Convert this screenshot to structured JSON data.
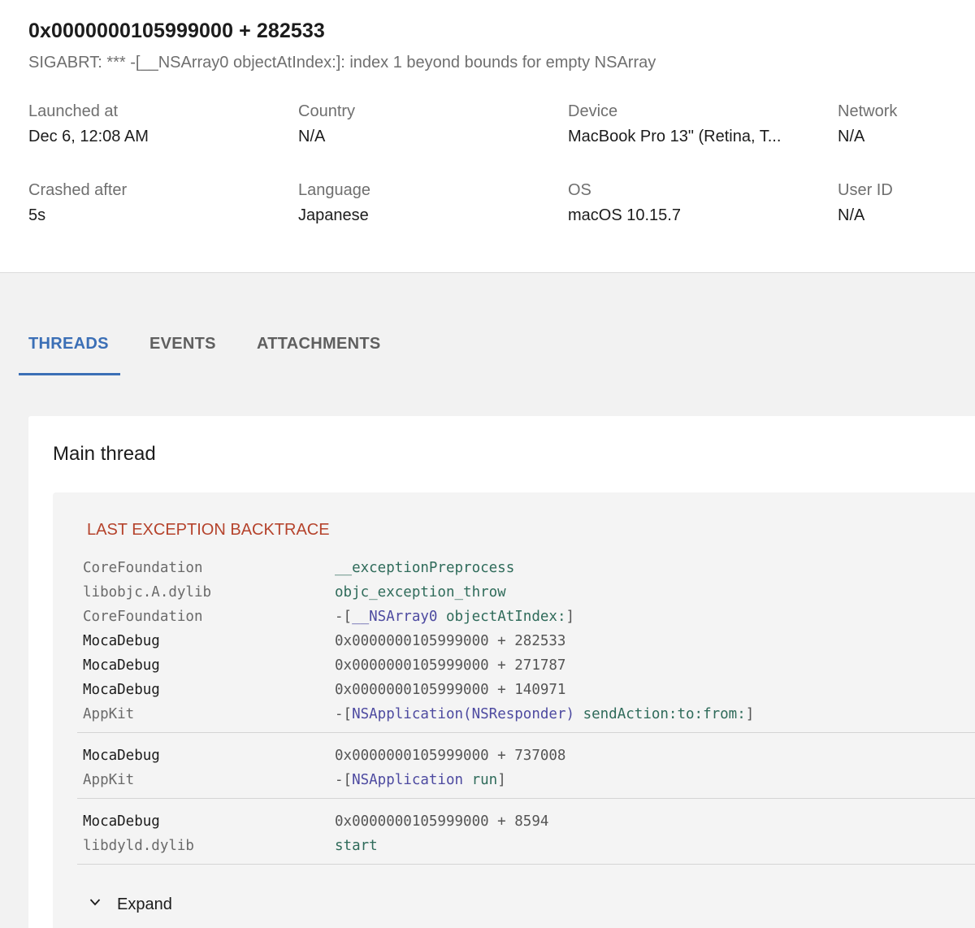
{
  "header": {
    "title": "0x0000000105999000 + 282533",
    "subtitle": "SIGABRT: *** -[__NSArray0 objectAtIndex:]: index 1 beyond bounds for empty NSArray"
  },
  "meta": {
    "launched_label": "Launched at",
    "launched_value": "Dec 6, 12:08 AM",
    "country_label": "Country",
    "country_value": "N/A",
    "device_label": "Device",
    "device_value": "MacBook Pro 13\" (Retina, T...",
    "network_label": "Network",
    "network_value": "N/A",
    "crashed_label": "Crashed after",
    "crashed_value": "5s",
    "language_label": "Language",
    "language_value": "Japanese",
    "os_label": "OS",
    "os_value": "macOS 10.15.7",
    "userid_label": "User ID",
    "userid_value": "N/A"
  },
  "tabs": [
    {
      "label": "THREADS",
      "active": true
    },
    {
      "label": "EVENTS",
      "active": false
    },
    {
      "label": "ATTACHMENTS",
      "active": false
    }
  ],
  "thread": {
    "title": "Main thread",
    "section_label": "LAST EXCEPTION BACKTRACE",
    "expand_label": "Expand",
    "groups": [
      [
        {
          "lib": "CoreFoundation",
          "app": false,
          "sym": "__exceptionPreprocess"
        },
        {
          "lib": "libobjc.A.dylib",
          "app": false,
          "sym": "objc_exception_throw"
        },
        {
          "lib": "CoreFoundation",
          "app": false,
          "prefix": "-[",
          "cls": "__NSArray0",
          "meth": "objectAtIndex:",
          "suffix": "]"
        },
        {
          "lib": "MocaDebug",
          "app": true,
          "addr": "0x0000000105999000 + 282533"
        },
        {
          "lib": "MocaDebug",
          "app": true,
          "addr": "0x0000000105999000 + 271787"
        },
        {
          "lib": "MocaDebug",
          "app": true,
          "addr": "0x0000000105999000 + 140971"
        },
        {
          "lib": "AppKit",
          "app": false,
          "prefix": "-[",
          "cls": "NSApplication(NSResponder)",
          "meth": "sendAction:to:from:",
          "suffix": "]"
        }
      ],
      [
        {
          "lib": "MocaDebug",
          "app": true,
          "addr": "0x0000000105999000 + 737008"
        },
        {
          "lib": "AppKit",
          "app": false,
          "prefix": "-[",
          "cls": "NSApplication",
          "meth": "run",
          "suffix": "]"
        }
      ],
      [
        {
          "lib": "MocaDebug",
          "app": true,
          "addr": "0x0000000105999000 + 8594"
        },
        {
          "lib": "libdyld.dylib",
          "app": false,
          "sym": "start"
        }
      ]
    ]
  },
  "colors": {
    "accent": "#3b6fb6",
    "exception_header": "#b5432c",
    "symbol_green": "#2f6b5a",
    "class_purple": "#4d4aa0"
  }
}
